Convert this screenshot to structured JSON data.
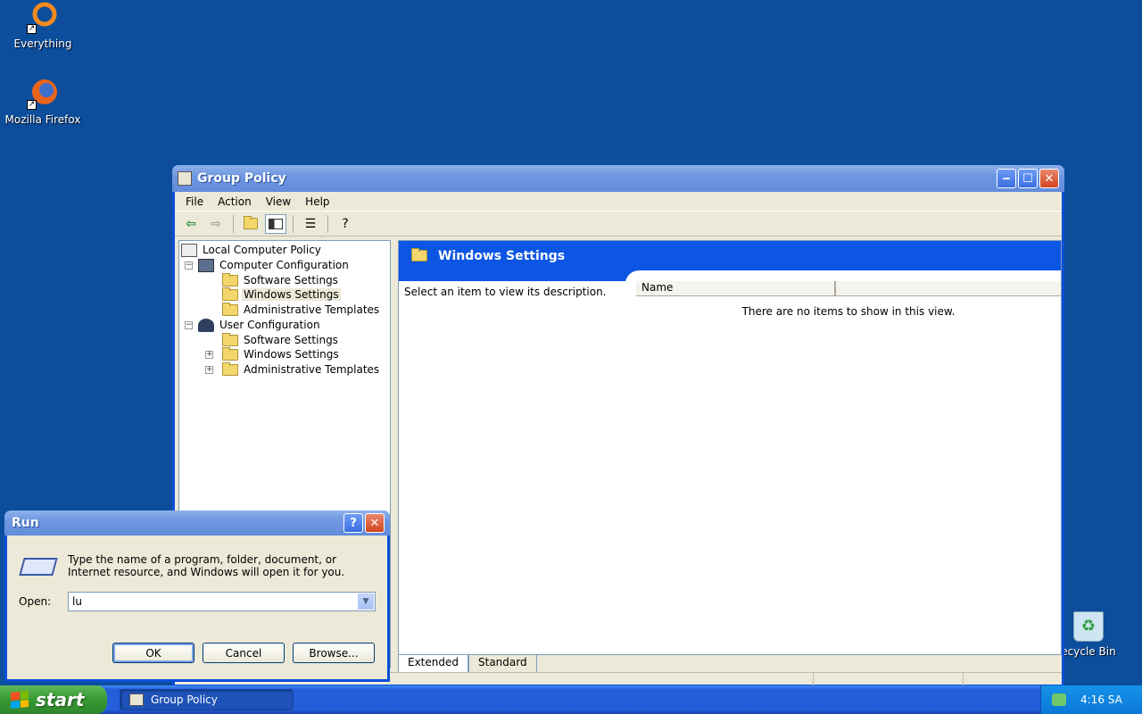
{
  "desktop": {
    "icons": [
      {
        "label": "Everything"
      },
      {
        "label": "Mozilla Firefox"
      },
      {
        "label": "ecycle Bin"
      }
    ]
  },
  "window": {
    "title": "Group Policy",
    "menu": [
      "File",
      "Action",
      "View",
      "Help"
    ],
    "tree": {
      "root": "Local Computer Policy",
      "computer": "Computer Configuration",
      "computer_children": [
        "Software Settings",
        "Windows Settings",
        "Administrative Templates"
      ],
      "user": "User Configuration",
      "user_children": [
        "Software Settings",
        "Windows Settings",
        "Administrative Templates"
      ]
    },
    "right_pane": {
      "header": "Windows Settings",
      "description": "Select an item to view its description.",
      "column_name": "Name",
      "empty_message": "There are no items to show in this view."
    },
    "tabs": [
      "Extended",
      "Standard"
    ]
  },
  "run_dialog": {
    "title": "Run",
    "description_line1": "Type the name of a program, folder, document, or",
    "description_line2": "Internet resource, and Windows will open it for you.",
    "open_label": "Open:",
    "open_value": "lu",
    "ok_label": "OK",
    "cancel_label": "Cancel",
    "browse_label": "Browse..."
  },
  "taskbar": {
    "start_label": "start",
    "task_label": "Group Policy",
    "clock": "4:16 SA"
  },
  "colors": {
    "desktop": "#0d4e9c",
    "title_active": "#0a4ed8",
    "pane_header": "#0d55e3"
  }
}
